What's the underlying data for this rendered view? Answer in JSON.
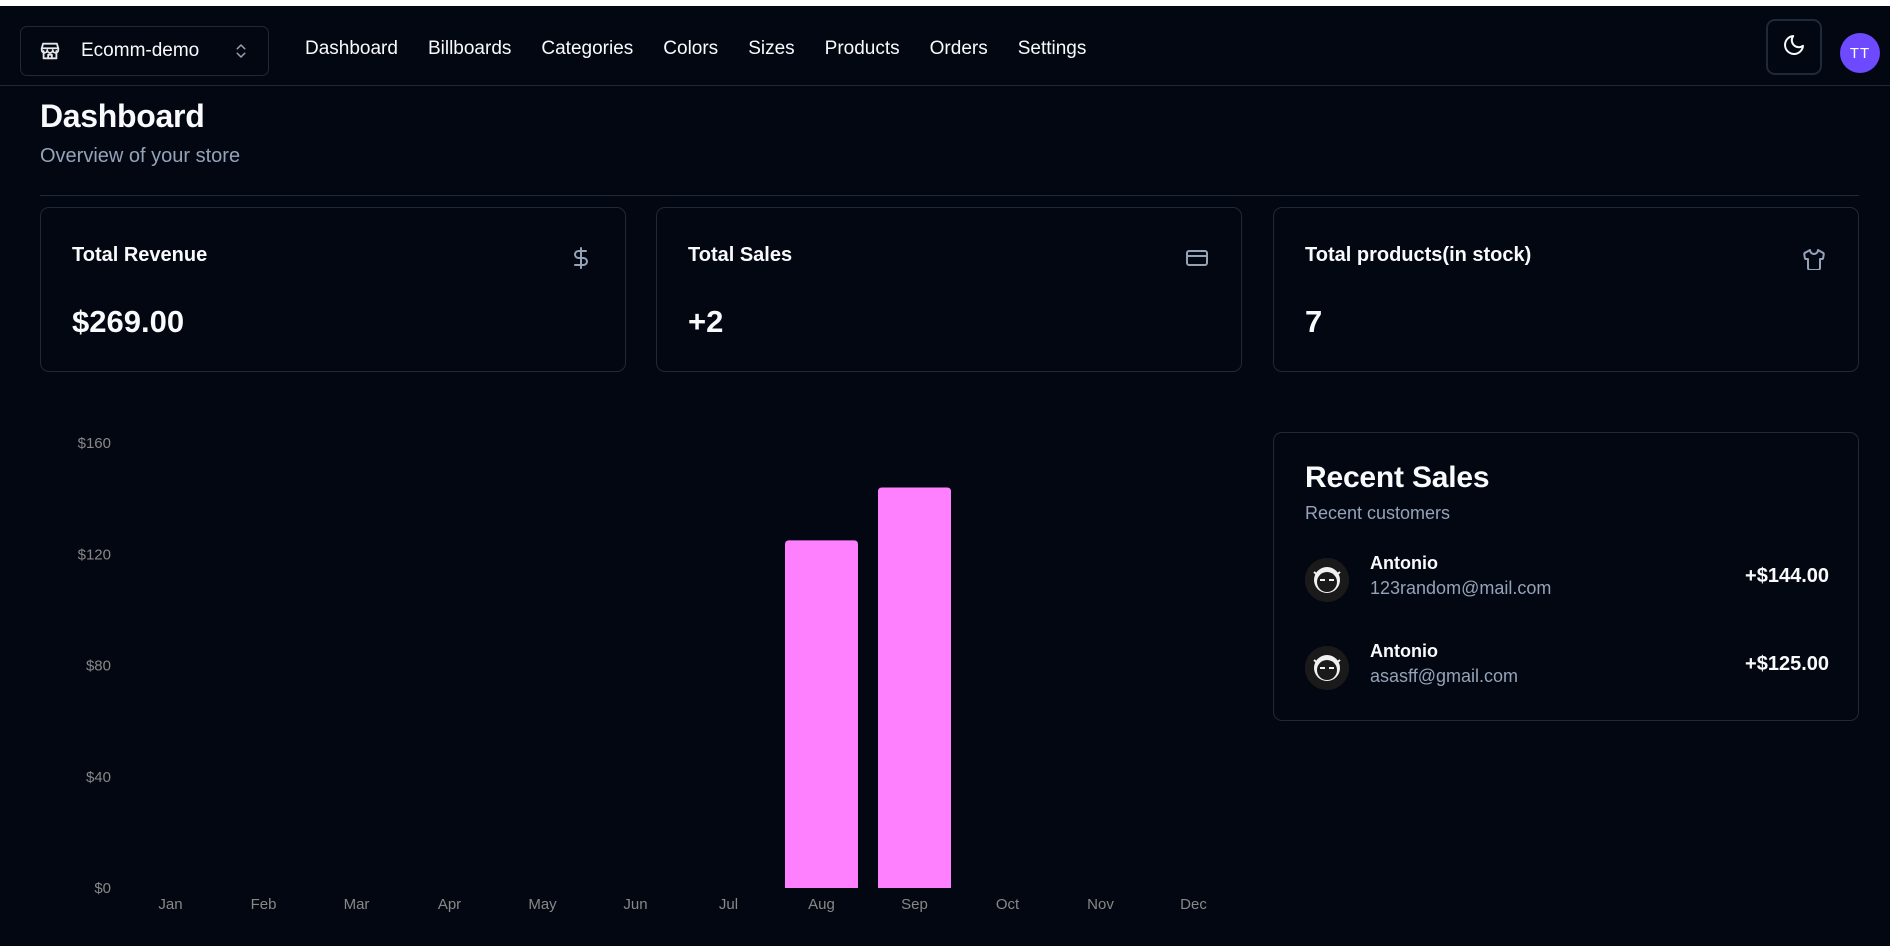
{
  "navbar": {
    "store_name": "Ecomm-demo",
    "links": [
      "Dashboard",
      "Billboards",
      "Categories",
      "Colors",
      "Sizes",
      "Products",
      "Orders",
      "Settings"
    ],
    "avatar_initials": "TT",
    "avatar_color": "#6d4aff"
  },
  "page": {
    "title": "Dashboard",
    "subtitle": "Overview of your store"
  },
  "cards": [
    {
      "title": "Total Revenue",
      "value": "$269.00",
      "icon": "dollar-icon"
    },
    {
      "title": "Total Sales",
      "value": "+2",
      "icon": "credit-card-icon"
    },
    {
      "title": "Total products(in stock)",
      "value": "7",
      "icon": "shirt-icon"
    }
  ],
  "chart_data": {
    "type": "bar",
    "categories": [
      "Jan",
      "Feb",
      "Mar",
      "Apr",
      "May",
      "Jun",
      "Jul",
      "Aug",
      "Sep",
      "Oct",
      "Nov",
      "Dec"
    ],
    "values": [
      0,
      0,
      0,
      0,
      0,
      0,
      0,
      125,
      144,
      0,
      0,
      0
    ],
    "y_ticks": [
      "$0",
      "$40",
      "$80",
      "$120",
      "$160"
    ],
    "ylim": [
      0,
      160
    ],
    "bar_color": "#ff80ff",
    "grid": false
  },
  "recent_sales": {
    "title": "Recent Sales",
    "subtitle": "Recent customers",
    "items": [
      {
        "name": "Antonio",
        "email": "123random@mail.com",
        "amount": "+$144.00"
      },
      {
        "name": "Antonio",
        "email": "asasff@gmail.com",
        "amount": "+$125.00"
      }
    ]
  }
}
